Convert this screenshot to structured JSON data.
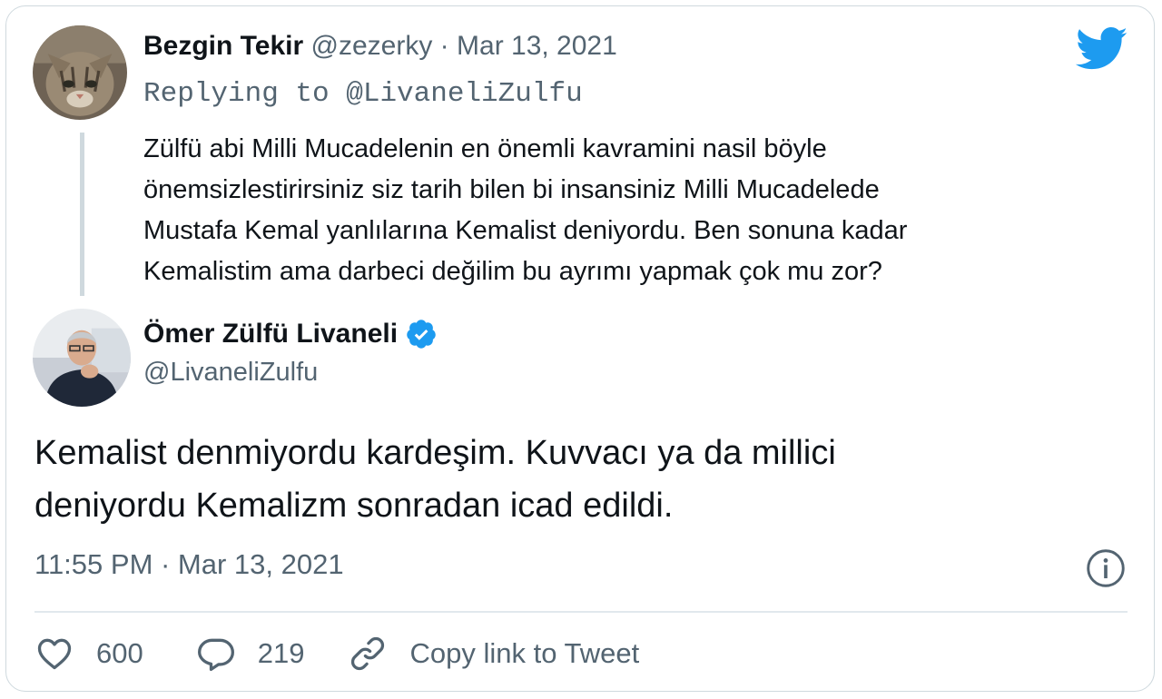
{
  "reply_tweet": {
    "name": "Bezgin Tekir",
    "handle": "@zezerky",
    "separator": "·",
    "date": "Mar 13, 2021",
    "replying_to": "Replying to @LivaneliZulfu",
    "text_lines": [
      "Zülfü abi Milli Mucadelenin en önemli kavramini nasil böyle",
      "önemsizlestirirsiniz siz tarih bilen bi insansiniz Milli Mucadelede",
      "Mustafa Kemal yanlılarına Kemalist deniyordu. Ben sonuna kadar",
      "Kemalistim ama darbeci değilim bu ayrımı yapmak çok mu zor?"
    ]
  },
  "main_tweet": {
    "name": "Ömer Zülfü Livaneli",
    "handle": "@LivaneliZulfu",
    "verified": true,
    "text_lines": [
      "Kemalist denmiyordu kardeşim. Kuvvacı ya da millici",
      "deniyordu Kemalizm sonradan icad edildi."
    ],
    "timestamp": "11:55 PM · Mar 13, 2021"
  },
  "actions": {
    "like_count": "600",
    "reply_count": "219",
    "copy_link_label": "Copy link to Tweet"
  },
  "icons": {
    "logo": "twitter-bird-icon",
    "verified": "verified-badge-icon",
    "info": "info-icon",
    "like": "heart-icon",
    "reply": "speech-bubble-icon",
    "link": "link-icon"
  },
  "colors": {
    "brand": "#1d9bf0",
    "text_primary": "#0f1419",
    "text_secondary": "#536471",
    "border": "#cfd9de"
  }
}
